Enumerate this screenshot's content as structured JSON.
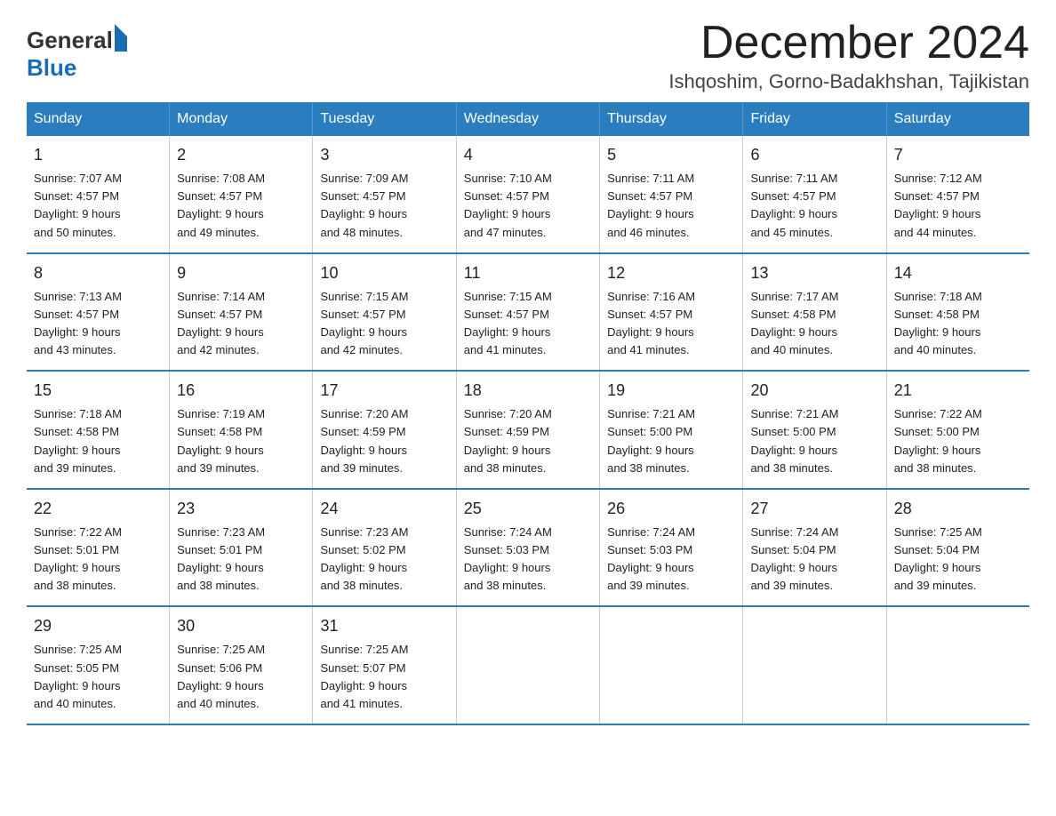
{
  "logo": {
    "general": "General",
    "blue": "Blue"
  },
  "title": "December 2024",
  "subtitle": "Ishqoshim, Gorno-Badakhshan, Tajikistan",
  "weekdays": [
    "Sunday",
    "Monday",
    "Tuesday",
    "Wednesday",
    "Thursday",
    "Friday",
    "Saturday"
  ],
  "weeks": [
    [
      {
        "day": "1",
        "sunrise": "7:07 AM",
        "sunset": "4:57 PM",
        "daylight": "9 hours and 50 minutes."
      },
      {
        "day": "2",
        "sunrise": "7:08 AM",
        "sunset": "4:57 PM",
        "daylight": "9 hours and 49 minutes."
      },
      {
        "day": "3",
        "sunrise": "7:09 AM",
        "sunset": "4:57 PM",
        "daylight": "9 hours and 48 minutes."
      },
      {
        "day": "4",
        "sunrise": "7:10 AM",
        "sunset": "4:57 PM",
        "daylight": "9 hours and 47 minutes."
      },
      {
        "day": "5",
        "sunrise": "7:11 AM",
        "sunset": "4:57 PM",
        "daylight": "9 hours and 46 minutes."
      },
      {
        "day": "6",
        "sunrise": "7:11 AM",
        "sunset": "4:57 PM",
        "daylight": "9 hours and 45 minutes."
      },
      {
        "day": "7",
        "sunrise": "7:12 AM",
        "sunset": "4:57 PM",
        "daylight": "9 hours and 44 minutes."
      }
    ],
    [
      {
        "day": "8",
        "sunrise": "7:13 AM",
        "sunset": "4:57 PM",
        "daylight": "9 hours and 43 minutes."
      },
      {
        "day": "9",
        "sunrise": "7:14 AM",
        "sunset": "4:57 PM",
        "daylight": "9 hours and 42 minutes."
      },
      {
        "day": "10",
        "sunrise": "7:15 AM",
        "sunset": "4:57 PM",
        "daylight": "9 hours and 42 minutes."
      },
      {
        "day": "11",
        "sunrise": "7:15 AM",
        "sunset": "4:57 PM",
        "daylight": "9 hours and 41 minutes."
      },
      {
        "day": "12",
        "sunrise": "7:16 AM",
        "sunset": "4:57 PM",
        "daylight": "9 hours and 41 minutes."
      },
      {
        "day": "13",
        "sunrise": "7:17 AM",
        "sunset": "4:58 PM",
        "daylight": "9 hours and 40 minutes."
      },
      {
        "day": "14",
        "sunrise": "7:18 AM",
        "sunset": "4:58 PM",
        "daylight": "9 hours and 40 minutes."
      }
    ],
    [
      {
        "day": "15",
        "sunrise": "7:18 AM",
        "sunset": "4:58 PM",
        "daylight": "9 hours and 39 minutes."
      },
      {
        "day": "16",
        "sunrise": "7:19 AM",
        "sunset": "4:58 PM",
        "daylight": "9 hours and 39 minutes."
      },
      {
        "day": "17",
        "sunrise": "7:20 AM",
        "sunset": "4:59 PM",
        "daylight": "9 hours and 39 minutes."
      },
      {
        "day": "18",
        "sunrise": "7:20 AM",
        "sunset": "4:59 PM",
        "daylight": "9 hours and 38 minutes."
      },
      {
        "day": "19",
        "sunrise": "7:21 AM",
        "sunset": "5:00 PM",
        "daylight": "9 hours and 38 minutes."
      },
      {
        "day": "20",
        "sunrise": "7:21 AM",
        "sunset": "5:00 PM",
        "daylight": "9 hours and 38 minutes."
      },
      {
        "day": "21",
        "sunrise": "7:22 AM",
        "sunset": "5:00 PM",
        "daylight": "9 hours and 38 minutes."
      }
    ],
    [
      {
        "day": "22",
        "sunrise": "7:22 AM",
        "sunset": "5:01 PM",
        "daylight": "9 hours and 38 minutes."
      },
      {
        "day": "23",
        "sunrise": "7:23 AM",
        "sunset": "5:01 PM",
        "daylight": "9 hours and 38 minutes."
      },
      {
        "day": "24",
        "sunrise": "7:23 AM",
        "sunset": "5:02 PM",
        "daylight": "9 hours and 38 minutes."
      },
      {
        "day": "25",
        "sunrise": "7:24 AM",
        "sunset": "5:03 PM",
        "daylight": "9 hours and 38 minutes."
      },
      {
        "day": "26",
        "sunrise": "7:24 AM",
        "sunset": "5:03 PM",
        "daylight": "9 hours and 39 minutes."
      },
      {
        "day": "27",
        "sunrise": "7:24 AM",
        "sunset": "5:04 PM",
        "daylight": "9 hours and 39 minutes."
      },
      {
        "day": "28",
        "sunrise": "7:25 AM",
        "sunset": "5:04 PM",
        "daylight": "9 hours and 39 minutes."
      }
    ],
    [
      {
        "day": "29",
        "sunrise": "7:25 AM",
        "sunset": "5:05 PM",
        "daylight": "9 hours and 40 minutes."
      },
      {
        "day": "30",
        "sunrise": "7:25 AM",
        "sunset": "5:06 PM",
        "daylight": "9 hours and 40 minutes."
      },
      {
        "day": "31",
        "sunrise": "7:25 AM",
        "sunset": "5:07 PM",
        "daylight": "9 hours and 41 minutes."
      },
      null,
      null,
      null,
      null
    ]
  ],
  "labels": {
    "sunrise": "Sunrise:",
    "sunset": "Sunset:",
    "daylight": "Daylight:"
  }
}
